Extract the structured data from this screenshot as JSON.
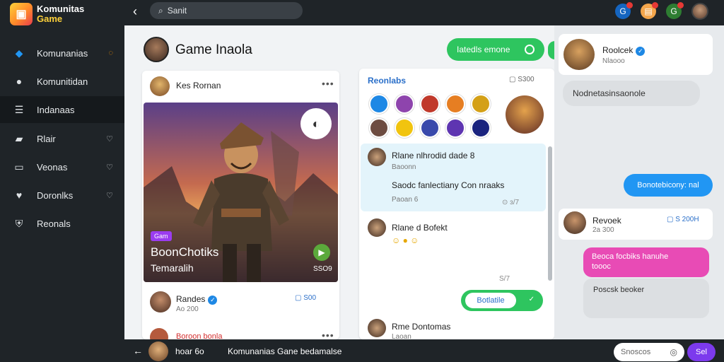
{
  "app": {
    "name_line1": "Komunitas",
    "name_line2": "Game"
  },
  "topbar": {
    "search_value": "Sanit"
  },
  "sidebar": {
    "items": [
      {
        "label": "Komunanias",
        "icon": "diamond-icon"
      },
      {
        "label": "Komunitidan",
        "icon": "user-icon"
      },
      {
        "label": "Indanaas",
        "icon": "list-icon"
      },
      {
        "label": "Rlair",
        "icon": "document-icon"
      },
      {
        "label": "Veonas",
        "icon": "card-icon"
      },
      {
        "label": "Doronlks",
        "icon": "heart-icon"
      },
      {
        "label": "Reonals",
        "icon": "shield-icon"
      }
    ]
  },
  "page": {
    "title": "Game Inaola"
  },
  "header": {
    "pill_label": "Iatedls emone"
  },
  "post": {
    "author": "Kes Rornan",
    "badge": "Gam",
    "title": "BoonChotiks",
    "subtitle": "Temaralih",
    "count": "SSO9",
    "footer_name": "Randes",
    "footer_sub": "Ao 200",
    "footer_stat": "S00",
    "second_title": "Boroon bonla"
  },
  "chat": {
    "title": "Reonlabs",
    "meta": "S300",
    "messages": [
      {
        "name": "Rlane nlhrodid dade 8",
        "sub": "Baoonn",
        "text": "Saodc fanlectiany Con nraaks",
        "extra": "Paoan 6",
        "time": "ɜ/7"
      },
      {
        "name": "Rlane d Bofekt",
        "sub": "",
        "text": "",
        "extra": "",
        "time": "S/7"
      },
      {
        "name": "Rme Dontomas",
        "sub": "Laoan",
        "text": "",
        "extra": "",
        "time": ""
      }
    ],
    "reply_label": "Botlatile"
  },
  "right": {
    "profile_name": "Roolcek",
    "profile_sub": "Nlaooo",
    "bubble1": "Nodnetasinsaonole",
    "bubble_blue": "Bonotebicony: nal",
    "card2_name": "Revoek",
    "card2_sub": "2a 300",
    "card2_stat": "S 200H",
    "pink_line1": "Beoca focbiks hanuhe",
    "pink_line2": "toooc",
    "gray2": "Poscsk beoker"
  },
  "bottombar": {
    "name": "hoar 6o",
    "title": "Komunanias Gane bedamalse",
    "input_placeholder": "Snoscos",
    "send_label": "Sel"
  },
  "colors": {
    "accent_green": "#2ec55f",
    "accent_blue": "#2196f3",
    "accent_purple": "#7c3aed",
    "accent_pink": "#e84bb5",
    "dark_bg": "#1f2428"
  }
}
